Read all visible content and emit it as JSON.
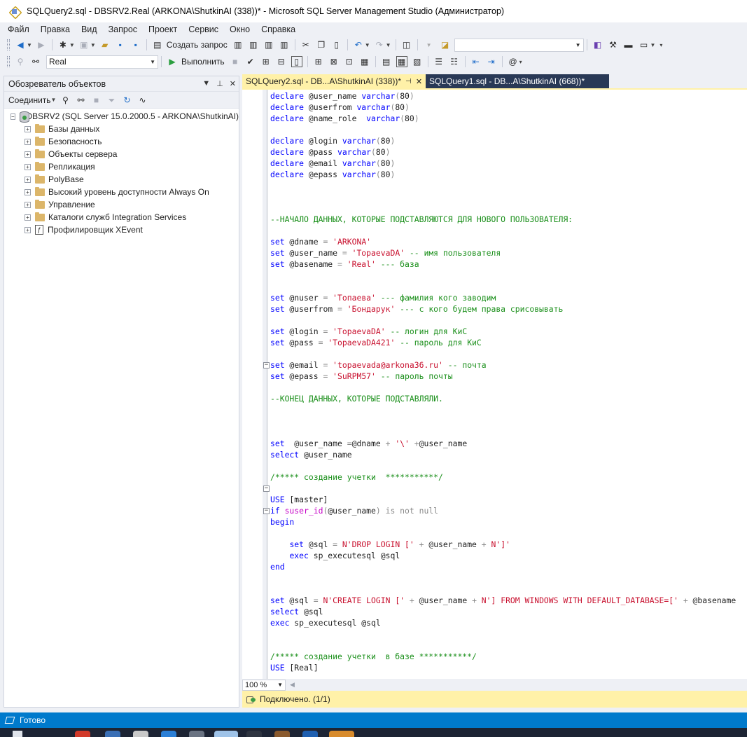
{
  "window": {
    "title": "SQLQuery2.sql - DBSRV2.Real (ARKONA\\ShutkinAI (338))* - Microsoft SQL Server Management Studio (Администратор)"
  },
  "menu": [
    "Файл",
    "Правка",
    "Вид",
    "Запрос",
    "Проект",
    "Сервис",
    "Окно",
    "Справка"
  ],
  "toolbar1": {
    "new_query_label": "Создать запрос",
    "solution_combo": ""
  },
  "toolbar2": {
    "database": "Real",
    "execute_label": "Выполнить"
  },
  "object_explorer": {
    "title": "Обозреватель объектов",
    "connect_label": "Соединить",
    "server": "DBSRV2 (SQL Server 15.0.2000.5 - ARKONA\\ShutkinAI)",
    "nodes": [
      "Базы данных",
      "Безопасность",
      "Объекты сервера",
      "Репликация",
      "PolyBase",
      "Высокий уровень доступности Always On",
      "Управление",
      "Каталоги служб Integration Services",
      "Профилировщик XEvent"
    ]
  },
  "tabs": [
    {
      "label": "SQLQuery2.sql - DB...A\\ShutkinAI (338))*",
      "active": true
    },
    {
      "label": "SQLQuery1.sql - DB...A\\ShutkinAI (668))*",
      "active": false
    }
  ],
  "editor": {
    "zoom": "100 %",
    "lines": [
      [
        [
          "kw",
          "declare"
        ],
        [
          "t",
          " @user_name "
        ],
        [
          "kw",
          "varchar"
        ],
        [
          "gr",
          "("
        ],
        [
          "t",
          "80"
        ],
        [
          "gr",
          ")"
        ]
      ],
      [
        [
          "kw",
          "declare"
        ],
        [
          "t",
          " @userfrom "
        ],
        [
          "kw",
          "varchar"
        ],
        [
          "gr",
          "("
        ],
        [
          "t",
          "80"
        ],
        [
          "gr",
          ")"
        ]
      ],
      [
        [
          "kw",
          "declare"
        ],
        [
          "t",
          " @name_role  "
        ],
        [
          "kw",
          "varchar"
        ],
        [
          "gr",
          "("
        ],
        [
          "t",
          "80"
        ],
        [
          "gr",
          ")"
        ]
      ],
      [],
      [
        [
          "kw",
          "declare"
        ],
        [
          "t",
          " @login "
        ],
        [
          "kw",
          "varchar"
        ],
        [
          "gr",
          "("
        ],
        [
          "t",
          "80"
        ],
        [
          "gr",
          ")"
        ]
      ],
      [
        [
          "kw",
          "declare"
        ],
        [
          "t",
          " @pass "
        ],
        [
          "kw",
          "varchar"
        ],
        [
          "gr",
          "("
        ],
        [
          "t",
          "80"
        ],
        [
          "gr",
          ")"
        ]
      ],
      [
        [
          "kw",
          "declare"
        ],
        [
          "t",
          " @email "
        ],
        [
          "kw",
          "varchar"
        ],
        [
          "gr",
          "("
        ],
        [
          "t",
          "80"
        ],
        [
          "gr",
          ")"
        ]
      ],
      [
        [
          "kw",
          "declare"
        ],
        [
          "t",
          " @epass "
        ],
        [
          "kw",
          "varchar"
        ],
        [
          "gr",
          "("
        ],
        [
          "t",
          "80"
        ],
        [
          "gr",
          ")"
        ]
      ],
      [],
      [],
      [],
      [
        [
          "cmt",
          "--НАЧАЛО ДАННЫХ, КОТОРЫЕ ПОДСТАВЛЯЮТСЯ ДЛЯ НОВОГО ПОЛЬЗОВАТЕЛЯ:"
        ]
      ],
      [],
      [
        [
          "kw",
          "set"
        ],
        [
          "t",
          " @dname "
        ],
        [
          "gr",
          "="
        ],
        [
          "t",
          " "
        ],
        [
          "str",
          "'ARKONA'"
        ]
      ],
      [
        [
          "kw",
          "set"
        ],
        [
          "t",
          " @user_name "
        ],
        [
          "gr",
          "="
        ],
        [
          "t",
          " "
        ],
        [
          "str",
          "'TopaevaDA'"
        ],
        [
          "t",
          " "
        ],
        [
          "cmt",
          "-- имя пользователя"
        ]
      ],
      [
        [
          "kw",
          "set"
        ],
        [
          "t",
          " @basename "
        ],
        [
          "gr",
          "="
        ],
        [
          "t",
          " "
        ],
        [
          "str",
          "'Real'"
        ],
        [
          "t",
          " "
        ],
        [
          "cmt",
          "--- база"
        ]
      ],
      [],
      [],
      [
        [
          "kw",
          "set"
        ],
        [
          "t",
          " @nuser "
        ],
        [
          "gr",
          "="
        ],
        [
          "t",
          " "
        ],
        [
          "str",
          "'Топаева'"
        ],
        [
          "t",
          " "
        ],
        [
          "cmt",
          "--- фамилия кого заводим"
        ]
      ],
      [
        [
          "kw",
          "set"
        ],
        [
          "t",
          " @userfrom "
        ],
        [
          "gr",
          "="
        ],
        [
          "t",
          " "
        ],
        [
          "str",
          "'Бондарук'"
        ],
        [
          "t",
          " "
        ],
        [
          "cmt",
          "--- с кого будем права срисовывать"
        ]
      ],
      [],
      [
        [
          "kw",
          "set"
        ],
        [
          "t",
          " @login "
        ],
        [
          "gr",
          "="
        ],
        [
          "t",
          " "
        ],
        [
          "str",
          "'TopaevaDA'"
        ],
        [
          "t",
          " "
        ],
        [
          "cmt",
          "-- логин для КиС"
        ]
      ],
      [
        [
          "kw",
          "set"
        ],
        [
          "t",
          " @pass "
        ],
        [
          "gr",
          "="
        ],
        [
          "t",
          " "
        ],
        [
          "str",
          "'TopaevaDA421'"
        ],
        [
          "t",
          " "
        ],
        [
          "cmt",
          "-- пароль для КиС"
        ]
      ],
      [],
      [
        [
          "kw",
          "set"
        ],
        [
          "t",
          " @email "
        ],
        [
          "gr",
          "="
        ],
        [
          "t",
          " "
        ],
        [
          "str",
          "'topaevada@arkona36.ru'"
        ],
        [
          "t",
          " "
        ],
        [
          "cmt",
          "-- почта"
        ]
      ],
      [
        [
          "kw",
          "set"
        ],
        [
          "t",
          " @epass "
        ],
        [
          "gr",
          "="
        ],
        [
          "t",
          " "
        ],
        [
          "str",
          "'SuRPM57'"
        ],
        [
          "t",
          " "
        ],
        [
          "cmt",
          "-- пароль почты"
        ]
      ],
      [],
      [
        [
          "cmt",
          "--КОНЕЦ ДАННЫХ, КОТОРЫЕ ПОДСТАВЛЯЛИ."
        ]
      ],
      [],
      [],
      [],
      [
        [
          "kw",
          "set"
        ],
        [
          "t",
          "  @user_name "
        ],
        [
          "gr",
          "="
        ],
        [
          "t",
          "@dname "
        ],
        [
          "gr",
          "+"
        ],
        [
          "t",
          " "
        ],
        [
          "str",
          "'\\'"
        ],
        [
          "t",
          " "
        ],
        [
          "gr",
          "+"
        ],
        [
          "t",
          "@user_name"
        ]
      ],
      [
        [
          "kw",
          "select"
        ],
        [
          "t",
          " @user_name"
        ]
      ],
      [],
      [
        [
          "cmt",
          "/***** создание учетки  ***********/"
        ]
      ],
      [],
      [
        [
          "kw",
          "USE"
        ],
        [
          "t",
          " [master]"
        ]
      ],
      [
        [
          "kw",
          "if"
        ],
        [
          "t",
          " "
        ],
        [
          "fn",
          "suser_id"
        ],
        [
          "gr",
          "("
        ],
        [
          "t",
          "@user_name"
        ],
        [
          "gr",
          ") is not null"
        ]
      ],
      [
        [
          "kw",
          "begin"
        ]
      ],
      [],
      [
        [
          "t",
          "    "
        ],
        [
          "kw",
          "set"
        ],
        [
          "t",
          " @sql "
        ],
        [
          "gr",
          "="
        ],
        [
          "t",
          " "
        ],
        [
          "str",
          "N'DROP LOGIN ['"
        ],
        [
          "t",
          " "
        ],
        [
          "gr",
          "+"
        ],
        [
          "t",
          " @user_name "
        ],
        [
          "gr",
          "+"
        ],
        [
          "t",
          " "
        ],
        [
          "str",
          "N']'"
        ]
      ],
      [
        [
          "t",
          "    "
        ],
        [
          "kw",
          "exec"
        ],
        [
          "t",
          " sp_executesql @sql"
        ]
      ],
      [
        [
          "kw",
          "end"
        ]
      ],
      [],
      [],
      [
        [
          "kw",
          "set"
        ],
        [
          "t",
          " @sql "
        ],
        [
          "gr",
          "="
        ],
        [
          "t",
          " "
        ],
        [
          "str",
          "N'CREATE LOGIN ['"
        ],
        [
          "t",
          " "
        ],
        [
          "gr",
          "+"
        ],
        [
          "t",
          " @user_name "
        ],
        [
          "gr",
          "+"
        ],
        [
          "t",
          " "
        ],
        [
          "str",
          "N'] FROM WINDOWS WITH DEFAULT_DATABASE=['"
        ],
        [
          "t",
          " "
        ],
        [
          "gr",
          "+"
        ],
        [
          "t",
          " @basename"
        ]
      ],
      [
        [
          "kw",
          "select"
        ],
        [
          "t",
          " @sql"
        ]
      ],
      [
        [
          "kw",
          "exec"
        ],
        [
          "t",
          " sp_executesql @sql"
        ]
      ],
      [],
      [],
      [
        [
          "cmt",
          "/***** создание учетки  в базе ***********/"
        ]
      ],
      [
        [
          "kw",
          "USE"
        ],
        [
          "t",
          " [Real]"
        ]
      ]
    ]
  },
  "infobar": {
    "status": "Подключено. (1/1)"
  },
  "statusbar": {
    "text": "Готово"
  }
}
